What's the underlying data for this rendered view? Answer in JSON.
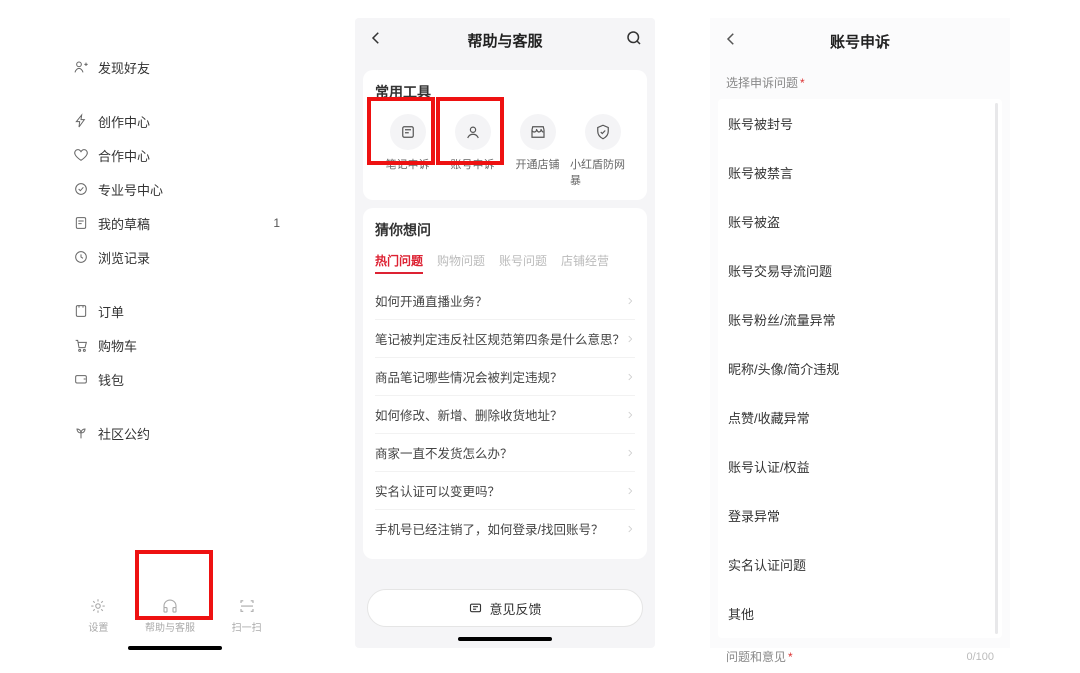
{
  "screen1": {
    "menu_a": [
      {
        "icon": "user-plus",
        "label": "发现好友"
      }
    ],
    "menu_b": [
      {
        "icon": "bolt",
        "label": "创作中心"
      },
      {
        "icon": "heart",
        "label": "合作中心"
      },
      {
        "icon": "verified",
        "label": "专业号中心"
      },
      {
        "icon": "draft",
        "label": "我的草稿",
        "badge": "1"
      },
      {
        "icon": "history",
        "label": "浏览记录"
      }
    ],
    "menu_c": [
      {
        "icon": "orders",
        "label": "订单"
      },
      {
        "icon": "cart",
        "label": "购物车"
      },
      {
        "icon": "wallet",
        "label": "钱包"
      }
    ],
    "menu_d": [
      {
        "icon": "sprout",
        "label": "社区公约"
      }
    ],
    "tabs": [
      {
        "icon": "gear",
        "label": "设置"
      },
      {
        "icon": "headset",
        "label": "帮助与客服"
      },
      {
        "icon": "scan",
        "label": "扫一扫"
      }
    ]
  },
  "screen2": {
    "title": "帮助与客服",
    "tools_title": "常用工具",
    "tools": [
      {
        "label": "笔记申诉",
        "icon": "note"
      },
      {
        "label": "账号申诉",
        "icon": "person"
      },
      {
        "label": "开通店铺",
        "icon": "store"
      },
      {
        "label": "小红盾防网暴",
        "icon": "shield"
      }
    ],
    "guess_title": "猜你想问",
    "qtabs": [
      "热门问题",
      "购物问题",
      "账号问题",
      "店铺经营"
    ],
    "questions": [
      "如何开通直播业务？",
      "笔记被判定违反社区规范第四条是什么意思？",
      "商品笔记哪些情况会被判定违规？",
      "如何修改、新增、删除收货地址？",
      "商家一直不发货怎么办？",
      "实名认证可以变更吗？",
      "手机号已经注销了，如何登录/找回账号？"
    ],
    "feedback": "意见反馈"
  },
  "screen3": {
    "title": "账号申诉",
    "select_label": "选择申诉问题",
    "options": [
      "账号被封号",
      "账号被禁言",
      "账号被盗",
      "账号交易导流问题",
      "账号粉丝/流量异常",
      "昵称/头像/简介违规",
      "点赞/收藏异常",
      "账号认证/权益",
      "登录异常",
      "实名认证问题",
      "其他"
    ],
    "comment_label": "问题和意见",
    "counter": "0/100"
  }
}
